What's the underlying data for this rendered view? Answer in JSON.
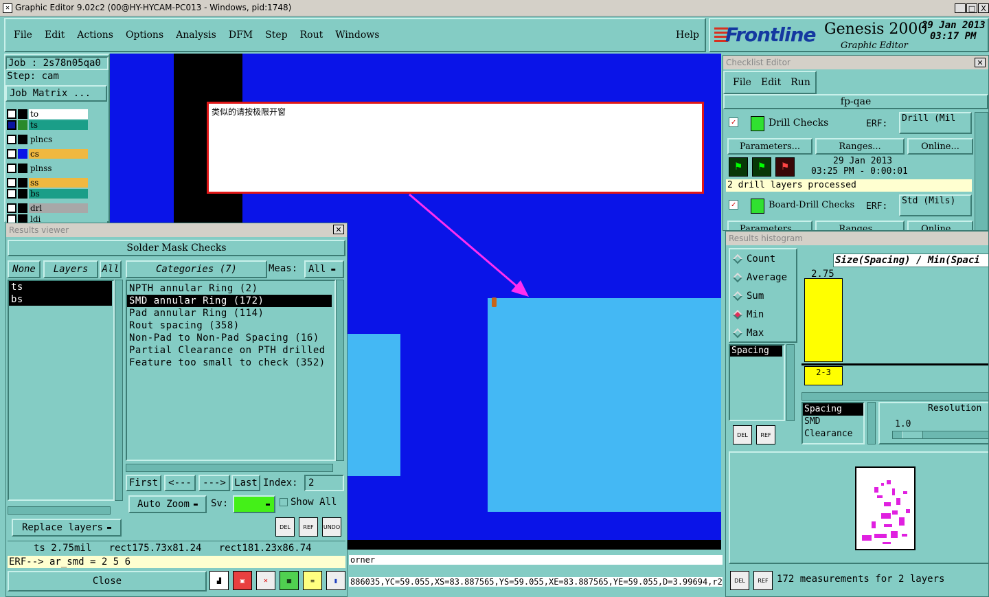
{
  "window": {
    "title": "Graphic Editor 9.02c2 (00@HY-HYCAM-PC013 - Windows, pid:1748)",
    "min": "_",
    "max": "□",
    "close": "X"
  },
  "menu": {
    "items": [
      "File",
      "Edit",
      "Actions",
      "Options",
      "Analysis",
      "DFM",
      "Step",
      "Rout",
      "Windows"
    ],
    "help": "Help"
  },
  "brand": {
    "logo": "Frontline",
    "product": "Genesis 2000",
    "subtitle": "Graphic Editor",
    "date": "29 Jan 2013",
    "time": "03:17 PM"
  },
  "job": {
    "job": "Job  : 2s78n05qa0",
    "step": "Step: cam",
    "matrix": "Job Matrix ..."
  },
  "layers": [
    {
      "name": "to",
      "color": "#ffffff"
    },
    {
      "name": "ts",
      "color": "#1a9e88"
    },
    {
      "name": "plncs",
      "color": "#84ccc4"
    },
    {
      "name": "cs",
      "color": "#f0b840"
    },
    {
      "name": "plnss",
      "color": "#84ccc4"
    },
    {
      "name": "ss",
      "color": "#f0b840"
    },
    {
      "name": "bs",
      "color": "#1a9e88"
    },
    {
      "name": "drl",
      "color": "#a8a8a8"
    },
    {
      "name": "ldi",
      "color": "#84ccc4"
    }
  ],
  "canvas": {
    "note": "类似的请按极限开窗",
    "status_line": "886035,YC=59.055,XS=83.887565,YS=59.055,XE=83.887565,YE=59.055,D=3.99694,r254,",
    "status_partial": "orner"
  },
  "results": {
    "title": "Results viewer",
    "header": "Solder Mask Checks",
    "none": "None",
    "layers": "Layers",
    "all": "All",
    "categories": "Categories (7)",
    "meas_label": "Meas:",
    "meas_value": "All",
    "layer_list": [
      "ts",
      "bs"
    ],
    "category_list": [
      "NPTH annular Ring (2)",
      "SMD annular Ring (172)",
      "Pad annular Ring (114)",
      "Rout spacing (358)",
      "Non-Pad to Non-Pad Spacing (16)",
      "Partial Clearance on PTH drilled",
      "Feature too small to check (352)"
    ],
    "selected_category": 1,
    "nav": {
      "first": "First",
      "prev": "<---",
      "next": "--->",
      "last": "Last",
      "index_label": "Index:",
      "index_value": "2"
    },
    "auto_zoom": "Auto Zoom",
    "sv": "Sv:",
    "show_all": "Show All",
    "replace_layers": "Replace layers",
    "info": "ts 2.75mil   rect175.73x81.24   rect181.23x86.74",
    "erf": "ERF--> ar_smd = 2 5 6",
    "close": "Close",
    "icons": {
      "del": "DEL",
      "ref": "REF",
      "undo": "UNDO"
    }
  },
  "checklist": {
    "title": "Checklist Editor",
    "menu": [
      "File",
      "Edit",
      "Run"
    ],
    "name": "fp-qae",
    "check1": {
      "name": "Drill Checks",
      "erf_label": "ERF:",
      "erf": "Drill (Mil"
    },
    "buttons": [
      "Parameters...",
      "Ranges...",
      "Online..."
    ],
    "date": "29 Jan 2013",
    "time": "03:25 PM - 0:00:01",
    "status": "2 drill layers processed",
    "check2": {
      "name": "Board-Drill Checks",
      "erf_label": "ERF:",
      "erf": "Std (Mils)"
    }
  },
  "histogram": {
    "title": "Results histogram",
    "options": [
      "Count",
      "Average",
      "Sum",
      "Min",
      "Max"
    ],
    "selected": "Min",
    "list": [
      "Spacing"
    ],
    "header": "Size(Spacing) / Min(Spaci",
    "value": "2.75",
    "bar_value": 2.75,
    "bar_label": "2-3",
    "types": [
      "Spacing",
      "SMD",
      "Clearance"
    ],
    "resolution_label": "Resolution",
    "resolution": "1.0",
    "footer": "172 measurements for 2 layers",
    "del": "DEL",
    "ref": "REF"
  }
}
